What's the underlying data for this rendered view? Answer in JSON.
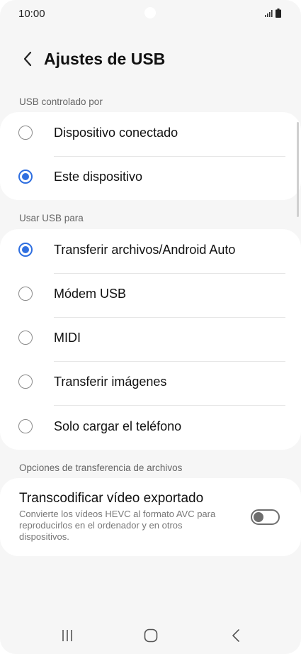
{
  "status_bar": {
    "time": "10:00"
  },
  "header": {
    "title": "Ajustes de USB"
  },
  "usb_controlled_by": {
    "label": "USB controlado por",
    "options": [
      {
        "label": "Dispositivo conectado",
        "selected": false
      },
      {
        "label": "Este dispositivo",
        "selected": true
      }
    ]
  },
  "use_usb_for": {
    "label": "Usar USB para",
    "options": [
      {
        "label": "Transferir archivos/Android Auto",
        "selected": true
      },
      {
        "label": "Módem USB",
        "selected": false
      },
      {
        "label": "MIDI",
        "selected": false
      },
      {
        "label": "Transferir imágenes",
        "selected": false
      },
      {
        "label": "Solo cargar el teléfono",
        "selected": false
      }
    ]
  },
  "file_transfer_options": {
    "label": "Opciones de transferencia de archivos",
    "transcode": {
      "title": "Transcodificar vídeo exportado",
      "description": "Convierte los vídeos HEVC al formato AVC para reproducirlos en el ordenador y en otros dispositivos.",
      "enabled": false
    }
  },
  "colors": {
    "accent": "#2f6fe0",
    "background": "#f6f6f6",
    "card": "#ffffff"
  }
}
